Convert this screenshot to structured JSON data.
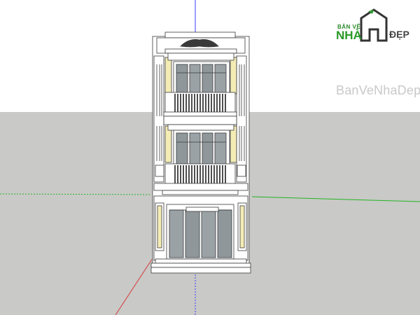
{
  "logo": {
    "line1": "BẢN VẼ",
    "line2": "NHÀ",
    "line3": "ĐẸP"
  },
  "watermark": "BanVeNhaDep",
  "colors": {
    "sky": "#ffffff",
    "ground": "#c9c9c7",
    "facade": "#ffffff",
    "trim": "#3a3a3a",
    "accent_panel": "#f3ecb5",
    "glass": "#8f979b",
    "axis_blue": "#3b3bff",
    "axis_green": "#23b423",
    "axis_red": "#d33a3a",
    "logo_green": "#2a9a2a"
  },
  "icons": [
    "house-logo-icon",
    "cornice-ornament-icon"
  ]
}
